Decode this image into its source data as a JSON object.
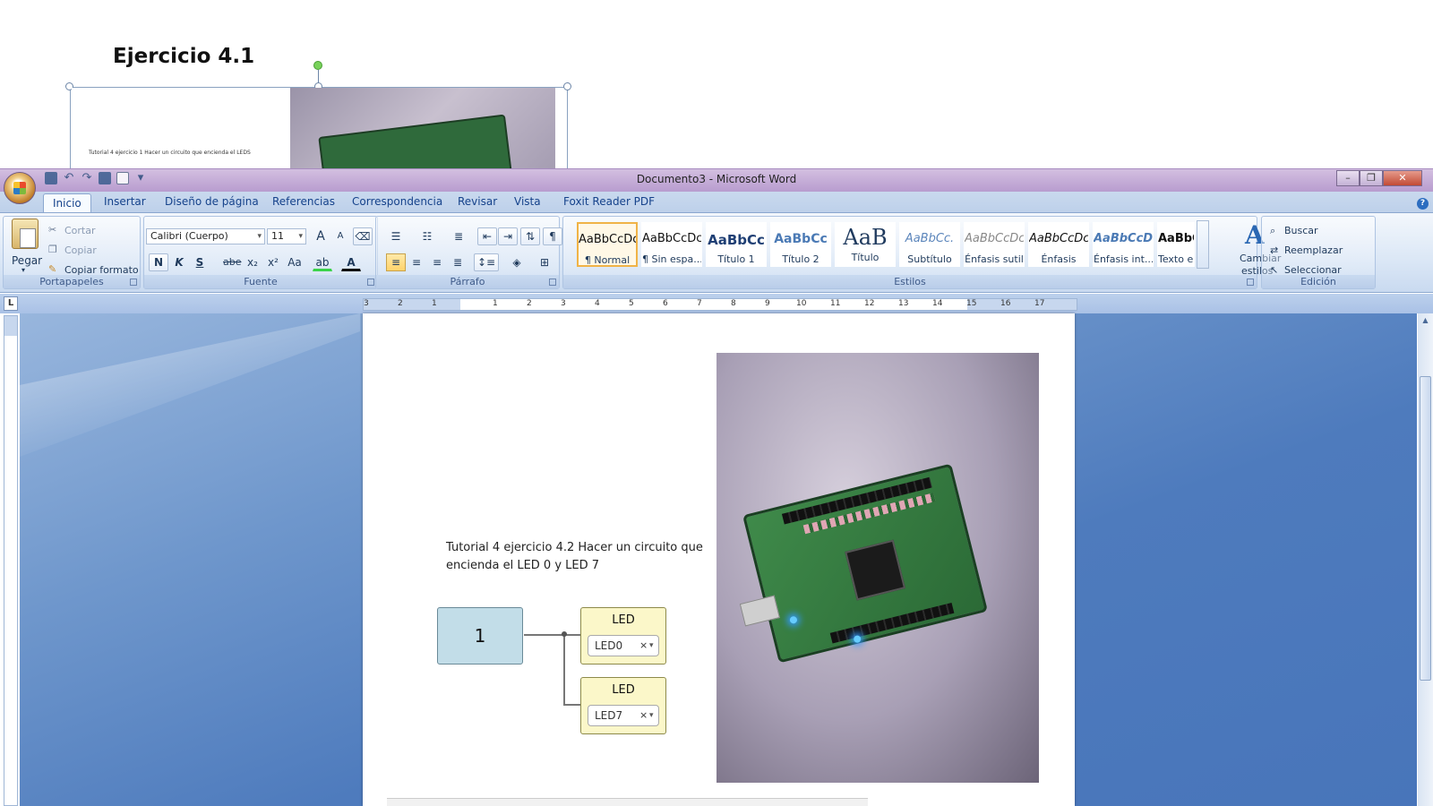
{
  "slide": {
    "heading": "Ejercicio 4.1",
    "thumbnail_text": "Tutorial 4 ejercicio 1 Hacer un circuito que encienda el LEDS"
  },
  "window": {
    "title": "Documento3 - Microsoft Word",
    "controls": {
      "minimize": "–",
      "restore": "❐",
      "close": "✕"
    },
    "help": "?"
  },
  "tabs": [
    "Inicio",
    "Insertar",
    "Diseño de página",
    "Referencias",
    "Correspondencia",
    "Revisar",
    "Vista",
    "Foxit Reader PDF"
  ],
  "ribbon": {
    "clipboard": {
      "label": "Portapapeles",
      "paste": "Pegar",
      "cut": "Cortar",
      "copy": "Copiar",
      "format_painter": "Copiar formato"
    },
    "font": {
      "label": "Fuente",
      "family": "Calibri (Cuerpo)",
      "size": "11",
      "grow": "A",
      "shrink": "A",
      "bold": "N",
      "italic": "K",
      "underline": "S",
      "strike": "abe",
      "subscript": "x₂",
      "superscript": "x²",
      "case": "Aa",
      "highlight": "ab",
      "color": "A"
    },
    "paragraph": {
      "label": "Párrafo",
      "pilcrow": "¶"
    },
    "styles": {
      "label": "Estilos",
      "items": [
        {
          "sample": "AaBbCcDc",
          "name": "¶ Normal"
        },
        {
          "sample": "AaBbCcDc",
          "name": "¶ Sin espa..."
        },
        {
          "sample": "AaBbCc",
          "name": "Título 1"
        },
        {
          "sample": "AaBbCc",
          "name": "Título 2"
        },
        {
          "sample": "AaB",
          "name": "Título"
        },
        {
          "sample": "AaBbCc.",
          "name": "Subtítulo"
        },
        {
          "sample": "AaBbCcDc",
          "name": "Énfasis sutil"
        },
        {
          "sample": "AaBbCcDc",
          "name": "Énfasis"
        },
        {
          "sample": "AaBbCcDc",
          "name": "Énfasis int..."
        },
        {
          "sample": "AaBbCcDc",
          "name": "Texto en n..."
        }
      ],
      "change_styles_line1": "Cambiar",
      "change_styles_line2": "estilos"
    },
    "editing": {
      "label": "Edición",
      "find": "Buscar",
      "replace": "Reemplazar",
      "select": "Seleccionar"
    }
  },
  "ruler": {
    "tab_selector": "L",
    "numbers": [
      "3",
      "2",
      "1",
      "1",
      "2",
      "3",
      "4",
      "5",
      "6",
      "7",
      "8",
      "9",
      "10",
      "11",
      "12",
      "13",
      "14",
      "15",
      "16",
      "17"
    ]
  },
  "document": {
    "text_line1": "Tutorial 4 ejercicio 4.2 Hacer un circuito que",
    "text_line2": "encienda el LED 0 y LED 7",
    "number_block": "1",
    "led_blocks": [
      {
        "title": "LED",
        "value": "LED0"
      },
      {
        "title": "LED",
        "value": "LED7"
      }
    ],
    "remove_glyph": "×",
    "dropdown_glyph": "▾"
  },
  "colors": {
    "accent": "#15428b",
    "ribbon": "#dbe7f6",
    "titlebar": "#c7b0da",
    "workspace": "#4e7bbd"
  }
}
